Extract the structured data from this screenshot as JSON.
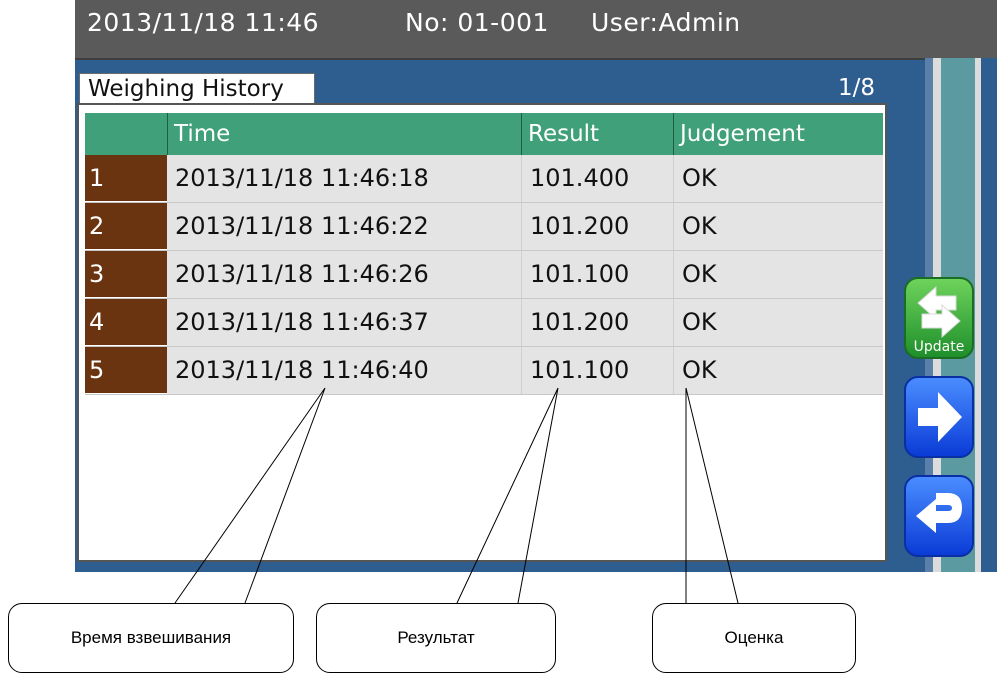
{
  "status": {
    "date_time": "2013/11/18  11:46",
    "number": "No: 01-001",
    "user": "User:Admin"
  },
  "tab": {
    "title": "Weighing History",
    "page_indicator": "1/8"
  },
  "table": {
    "headers": [
      "",
      "Time",
      "Result",
      "Judgement"
    ],
    "rows": [
      {
        "index": "1",
        "time": "2013/11/18 11:46:18",
        "result": "101.400",
        "judgement": "OK"
      },
      {
        "index": "2",
        "time": "2013/11/18 11:46:22",
        "result": "101.200",
        "judgement": "OK"
      },
      {
        "index": "3",
        "time": "2013/11/18 11:46:26",
        "result": "101.100",
        "judgement": "OK"
      },
      {
        "index": "4",
        "time": "2013/11/18 11:46:37",
        "result": "101.200",
        "judgement": "OK"
      },
      {
        "index": "5",
        "time": "2013/11/18 11:46:40",
        "result": "101.100",
        "judgement": "OK"
      }
    ]
  },
  "buttons": {
    "update_label": "Update"
  },
  "callouts": {
    "time": "Время взвешивания",
    "result": "Результат",
    "judgement": "Оценка"
  },
  "colors": {
    "header_green": "#3fa07a",
    "row_index_brown": "#6b3410",
    "screen_blue": "#2e5d8f",
    "update_green": "#1e8f2b",
    "nav_blue": "#0b3bd6"
  },
  "icons": {
    "update": "swap-arrows-icon",
    "next": "arrow-right-icon",
    "back": "return-arrow-icon"
  }
}
